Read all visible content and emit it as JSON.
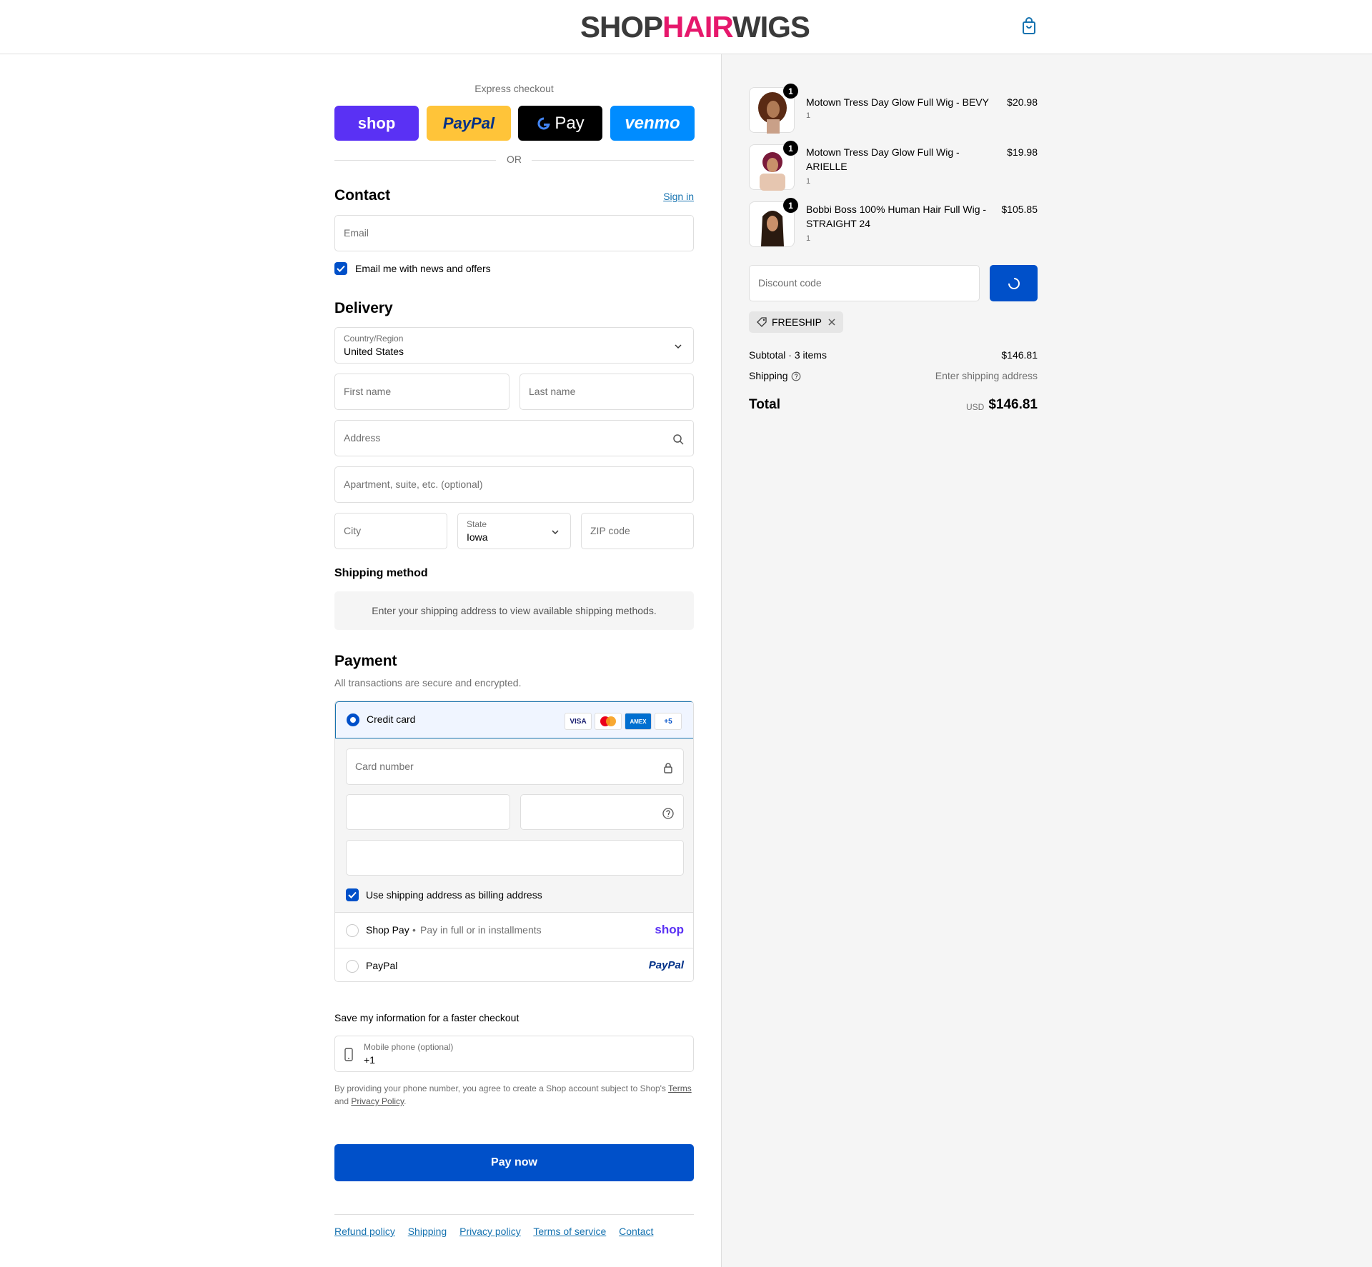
{
  "header": {
    "logo_shop": "SHOP",
    "logo_hair": "HAIR",
    "logo_wigs": "WIGS",
    "cart_icon": "shopping-bag-icon"
  },
  "express": {
    "label": "Express checkout",
    "shop_pay": "shop",
    "paypal": "PayPal",
    "gpay": "G Pay",
    "venmo": "venmo",
    "or": "OR"
  },
  "contact": {
    "title": "Contact",
    "sign_in": "Sign in",
    "email_placeholder": "Email",
    "news_label": "Email me with news and offers"
  },
  "delivery": {
    "title": "Delivery",
    "country_label": "Country/Region",
    "country_value": "United States",
    "first_name": "First name",
    "last_name": "Last name",
    "address": "Address",
    "apartment": "Apartment, suite, etc. (optional)",
    "city": "City",
    "state_label": "State",
    "state_value": "Iowa",
    "zip": "ZIP code"
  },
  "shipping_method": {
    "title": "Shipping method",
    "info": "Enter your shipping address to view available shipping methods."
  },
  "payment": {
    "title": "Payment",
    "subtitle": "All transactions are secure and encrypted.",
    "credit_card": "Credit card",
    "badges": [
      "VISA",
      "",
      "AMEX",
      "+5"
    ],
    "card_number": "Card number",
    "billing_label": "Use shipping address as billing address",
    "shop_pay": "Shop Pay",
    "shop_pay_sub": "Pay in full or in installments",
    "shop_pay_logo": "shop",
    "paypal": "PayPal",
    "paypal_logo": "PayPal"
  },
  "save_info": {
    "title": "Save my information for a faster checkout",
    "phone_label": "Mobile phone (optional)",
    "phone_value": "+1",
    "disclaimer_pre": "By providing your phone number, you agree to create a Shop account subject to Shop's ",
    "terms": "Terms",
    "and": "and ",
    "privacy": "Privacy Policy",
    "dot": "."
  },
  "pay_now": "Pay now",
  "footer": [
    "Refund policy",
    "Shipping",
    "Privacy policy",
    "Terms of service",
    "Contact"
  ],
  "order": {
    "items": [
      {
        "name": "Motown Tress Day Glow Full Wig - BEVY",
        "qty": "1",
        "sub": "1",
        "price": "$20.98"
      },
      {
        "name": "Motown Tress Day Glow Full Wig - ARIELLE",
        "qty": "1",
        "sub": "1",
        "price": "$19.98"
      },
      {
        "name": "Bobbi Boss 100% Human Hair Full Wig - STRAIGHT 24",
        "qty": "1",
        "sub": "1",
        "price": "$105.85"
      }
    ],
    "discount_placeholder": "Discount code",
    "applied_code": "FREESHIP",
    "subtotal_label": "Subtotal · 3 items",
    "subtotal_value": "$146.81",
    "shipping_label": "Shipping",
    "shipping_value": "Enter shipping address",
    "total_label": "Total",
    "currency": "USD",
    "total_value": "$146.81"
  }
}
